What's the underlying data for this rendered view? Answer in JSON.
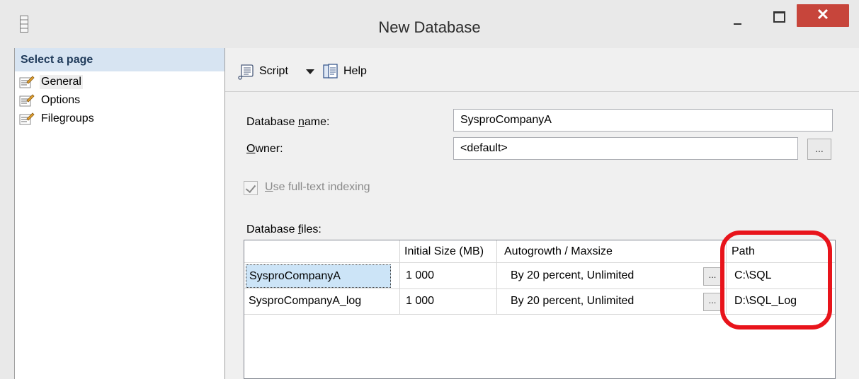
{
  "window": {
    "title": "New Database",
    "close_label": "✕"
  },
  "sidebar": {
    "header": "Select a page",
    "items": [
      {
        "label": "General",
        "selected": true
      },
      {
        "label": "Options",
        "selected": false
      },
      {
        "label": "Filegroups",
        "selected": false
      }
    ]
  },
  "toolbar": {
    "script_label": "Script",
    "help_label": "Help"
  },
  "form": {
    "db_name_label_pre": "Database ",
    "db_name_label_u": "n",
    "db_name_label_post": "ame:",
    "db_name_value": "SysproCompanyA",
    "owner_label_u": "O",
    "owner_label_post": "wner:",
    "owner_value": "<default>",
    "browse_label": "...",
    "fulltext_u": "U",
    "fulltext_post": "se full-text indexing",
    "fulltext_checked": true,
    "files_label_pre": "Database ",
    "files_label_u": "f",
    "files_label_post": "iles:"
  },
  "grid": {
    "columns": [
      "",
      "Initial Size (MB)",
      "Autogrowth / Maxsize",
      "Path"
    ],
    "rows": [
      {
        "name": "SysproCompanyA",
        "size": "1 000",
        "autogrowth": "By 20 percent, Unlimited",
        "path": "C:\\SQL"
      },
      {
        "name": "SysproCompanyA_log",
        "size": "1 000",
        "autogrowth": "By 20 percent, Unlimited",
        "path": "D:\\SQL_Log"
      }
    ],
    "cell_button_label": "..."
  },
  "colors": {
    "highlight": "#e8141b",
    "close_button": "#c7453b",
    "sidebar_header": "#d7e4f2"
  },
  "icons": {
    "title": "database-icon",
    "page": "page-properties-icon",
    "script": "script-icon",
    "help": "help-icon"
  }
}
